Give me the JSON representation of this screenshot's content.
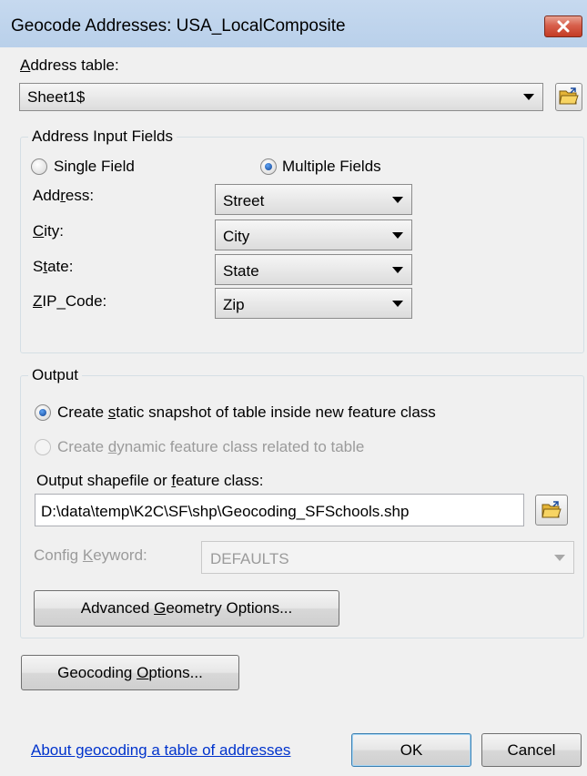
{
  "window": {
    "title": "Geocode Addresses:  USA_LocalComposite"
  },
  "address_table": {
    "label": "Address table:",
    "value": "Sheet1$"
  },
  "input_fields": {
    "group_label": "Address Input Fields",
    "single_field_label": "Single Field",
    "multiple_fields_label": "Multiple Fields",
    "selected_mode": "Multiple Fields",
    "rows": [
      {
        "label": "Address:",
        "value": "Street"
      },
      {
        "label": "City:",
        "value": "City"
      },
      {
        "label": "State:",
        "value": "State"
      },
      {
        "label": "ZIP_Code:",
        "value": "Zip"
      }
    ]
  },
  "output": {
    "group_label": "Output",
    "option_static": "Create static snapshot of table inside new feature class",
    "option_dynamic": "Create dynamic feature class related to table",
    "selected_option": "static",
    "shapefile_label": "Output shapefile or feature class:",
    "shapefile_value": "D:\\data\\temp\\K2C\\SF\\shp\\Geocoding_SFSchools.shp",
    "config_keyword_label": "Config Keyword:",
    "config_keyword_value": "DEFAULTS",
    "advanced_button": "Advanced Geometry Options..."
  },
  "buttons": {
    "geocoding_options": "Geocoding Options...",
    "ok": "OK",
    "cancel": "Cancel"
  },
  "help_link": "About geocoding a table of addresses",
  "icons": {
    "close": "close-x-icon",
    "folder": "open-folder-icon",
    "dropdown": "chevron-down-icon"
  },
  "colors": {
    "titlebar": "#b9d0ea",
    "close_button": "#c33b25",
    "link": "#0033cc",
    "radio_selected": "#1a5bb8"
  }
}
